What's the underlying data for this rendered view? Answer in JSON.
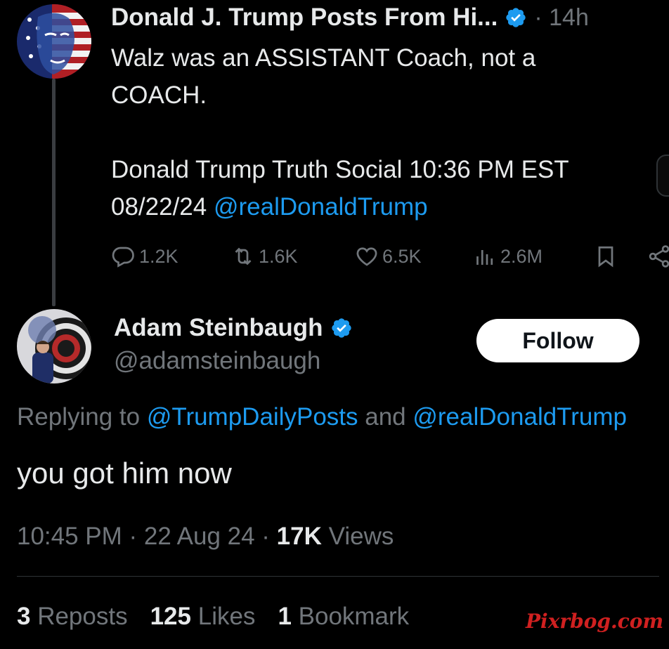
{
  "colors": {
    "background": "#000000",
    "text": "#e7e9ea",
    "secondary_text": "#71767b",
    "link": "#1d9bf0",
    "verified": "#1d9bf0",
    "follow_button_bg": "#ffffff",
    "watermark": "#d02020"
  },
  "parent_tweet": {
    "author_name": "Donald J. Trump Posts From Hi...",
    "verified_icon": "verified-badge-icon",
    "time": "· 14h",
    "lines": [
      "Walz was an ASSISTANT Coach, not a",
      "COACH.",
      "Donald Trump Truth Social 10:36 PM EST"
    ],
    "date_prefix": "08/22/24 ",
    "mention": "@realDonaldTrump",
    "actions": {
      "replies": "1.2K",
      "reposts": "1.6K",
      "likes": "6.5K",
      "views": "2.6M"
    }
  },
  "reply_tweet": {
    "author_name": "Adam Steinbaugh",
    "handle": "@adamsteinbaugh",
    "follow_label": "Follow",
    "replying_prefix": "Replying to ",
    "replying_mention_1": "@TrumpDailyPosts",
    "replying_and": " and ",
    "replying_mention_2": "@realDonaldTrump",
    "text": "you got him now",
    "time": "10:45 PM · 22 Aug 24 · ",
    "views_count": "17K",
    "views_label": " Views",
    "stats": {
      "reposts_count": "3",
      "reposts_label": " Reposts",
      "likes_count": "125",
      "likes_label": " Likes",
      "bookmarks_count": "1",
      "bookmarks_label": " Bookmark"
    }
  },
  "watermark": "Pixrbog.com"
}
